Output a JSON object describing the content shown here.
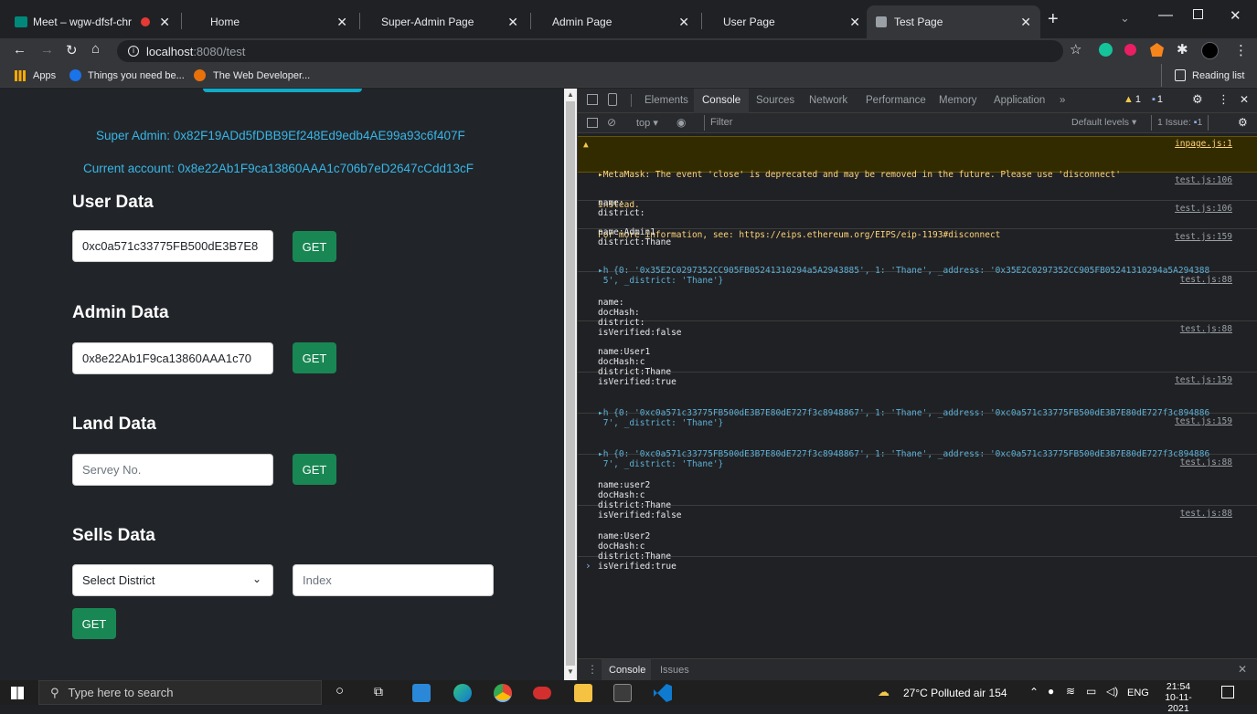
{
  "browser": {
    "tabs": [
      {
        "label": "Meet – wgw-dfsf-chr",
        "active": false
      },
      {
        "label": "Home",
        "active": false
      },
      {
        "label": "Super-Admin Page",
        "active": false
      },
      {
        "label": "Admin Page",
        "active": false
      },
      {
        "label": "User Page",
        "active": false
      },
      {
        "label": "Test Page",
        "active": true
      }
    ],
    "url_host": "localhost",
    "url_path": ":8080/test",
    "bookmarks": [
      "Apps",
      "Things you need be...",
      "The Web Developer..."
    ],
    "reading_list": "Reading list"
  },
  "page": {
    "super_admin": "Super Admin: 0x82F19ADd5fDBB9Ef248Ed9edb4AE99a93c6f407F",
    "current_account": "Current account: 0x8e22Ab1F9ca13860AAA1c706b7eD2647cCdd13cF",
    "sections": {
      "user": {
        "title": "User Data",
        "value": "0xc0a571c33775FB500dE3B7E8"
      },
      "admin": {
        "title": "Admin Data",
        "value": "0x8e22Ab1F9ca13860AAA1c70"
      },
      "land": {
        "title": "Land Data",
        "placeholder": "Servey No."
      },
      "sells": {
        "title": "Sells Data",
        "select": "Select District",
        "placeholder": "Index"
      }
    },
    "get_label": "GET"
  },
  "devtools": {
    "tabs": [
      "Elements",
      "Console",
      "Sources",
      "Network",
      "Performance",
      "Memory",
      "Application",
      "»"
    ],
    "warn_count": "1",
    "info_count": "1",
    "context": "top",
    "filter_placeholder": "Filter",
    "levels": "Default levels",
    "issues": "1 Issue:",
    "issue_count": "1",
    "warning": {
      "line1": "▸MetaMask: The event 'close' is deprecated and may be removed in the future. Please use 'disconnect'",
      "line2": "instead.",
      "line3": "For more information, see: https://eips.ethereum.org/EIPS/eip-1193#disconnect",
      "src": "inpage.js:1"
    },
    "messages": [
      {
        "text": "name:\ndistrict:",
        "src": "test.js:106"
      },
      {
        "text": "name:Admin1\ndistrict:Thane",
        "src": "test.js:106"
      },
      {
        "text": "▸h {0: '0x35E2C0297352CC905FB05241310294a5A2943885', 1: 'Thane', _address: '0x35E2C0297352CC905FB05241310294a5A294388\n 5', _district: 'Thane'}",
        "src": "test.js:159"
      },
      {
        "text": "name:\ndocHash:\ndistrict:\nisVerified:false",
        "src": "test.js:88"
      },
      {
        "text": "name:User1\ndocHash:c\ndistrict:Thane\nisVerified:true",
        "src": "test.js:88"
      },
      {
        "text": "▸h {0: '0xc0a571c33775FB500dE3B7E80dE727f3c8948867', 1: 'Thane', _address: '0xc0a571c33775FB500dE3B7E80dE727f3c894886\n 7', _district: 'Thane'}",
        "src": "test.js:159"
      },
      {
        "text": "▸h {0: '0xc0a571c33775FB500dE3B7E80dE727f3c8948867', 1: 'Thane', _address: '0xc0a571c33775FB500dE3B7E80dE727f3c894886\n 7', _district: 'Thane'}",
        "src": "test.js:159"
      },
      {
        "text": "name:user2\ndocHash:c\ndistrict:Thane\nisVerified:false",
        "src": "test.js:88"
      },
      {
        "text": "name:User2\ndocHash:c\ndistrict:Thane\nisVerified:true",
        "src": "test.js:88"
      }
    ],
    "prompt": "›",
    "drawer_tabs": [
      "Console",
      "Issues"
    ]
  },
  "taskbar": {
    "search_placeholder": "Type here to search",
    "weather": "27°C  Polluted air 154",
    "lang": "ENG",
    "time": "21:54",
    "date": "10-11-2021"
  },
  "colors": {
    "accent_green": "#198754",
    "account_blue": "#38b6e8",
    "warn_bg": "#332b00"
  }
}
